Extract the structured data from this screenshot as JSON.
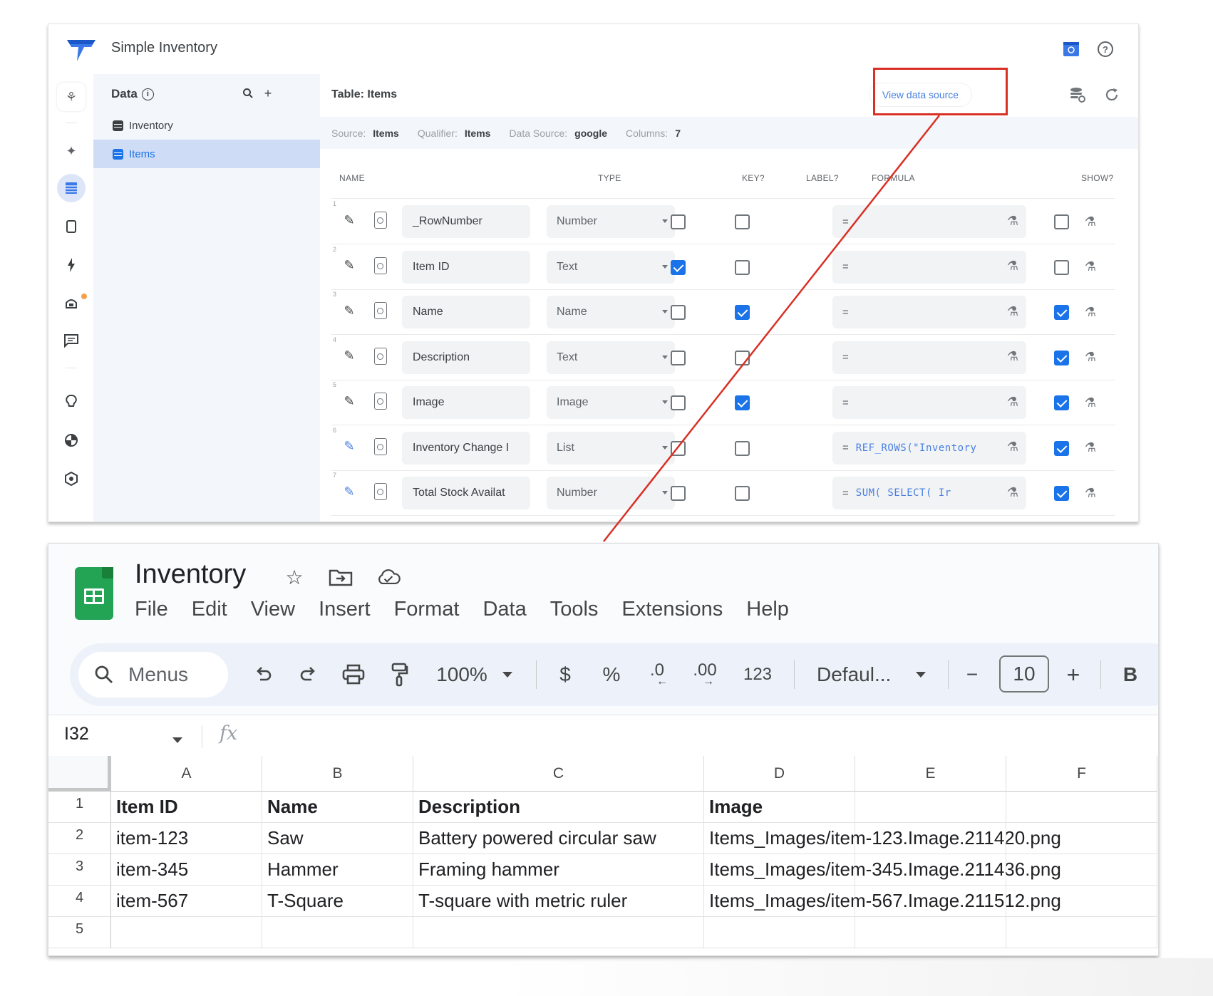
{
  "appsheet": {
    "app_title": "Simple Inventory",
    "header_icons": [
      "preview-icon",
      "help-icon"
    ],
    "rail_icons": [
      "app-flow-icon",
      "sparkle-icon",
      "data-icon",
      "views-icon",
      "actions-icon",
      "automation-icon",
      "chat-icon",
      "ideas-icon",
      "security-icon",
      "settings-icon"
    ],
    "data_panel": {
      "title": "Data",
      "tables": [
        {
          "label": "Inventory",
          "active": false
        },
        {
          "label": "Items",
          "active": true
        }
      ]
    },
    "main": {
      "title": "Table: Items",
      "view_data_source_label": "View data source",
      "meta": {
        "source_label": "Source:",
        "source_value": "Items",
        "qualifier_label": "Qualifier:",
        "qualifier_value": "Items",
        "datasource_label": "Data Source:",
        "datasource_value": "google",
        "columns_label": "Columns:",
        "columns_value": "7"
      },
      "column_headers": {
        "name": "NAME",
        "type": "TYPE",
        "key": "KEY?",
        "label": "LABEL?",
        "formula": "FORMULA",
        "show": "SHOW?"
      },
      "rows": [
        {
          "num": "1",
          "name": "_RowNumber",
          "type": "Number",
          "key": false,
          "label": false,
          "formula": "",
          "show": false,
          "edited": false
        },
        {
          "num": "2",
          "name": "Item ID",
          "type": "Text",
          "key": true,
          "label": false,
          "formula": "",
          "show": false,
          "edited": false
        },
        {
          "num": "3",
          "name": "Name",
          "type": "Name",
          "key": false,
          "label": true,
          "formula": "",
          "show": true,
          "edited": false
        },
        {
          "num": "4",
          "name": "Description",
          "type": "Text",
          "key": false,
          "label": false,
          "formula": "",
          "show": true,
          "edited": false
        },
        {
          "num": "5",
          "name": "Image",
          "type": "Image",
          "key": false,
          "label": true,
          "formula": "",
          "show": true,
          "edited": false
        },
        {
          "num": "6",
          "name": "Inventory Change I",
          "type": "List",
          "key": false,
          "label": false,
          "formula": "REF_ROWS(\"Inventory",
          "show": true,
          "edited": true
        },
        {
          "num": "7",
          "name": "Total Stock Availat",
          "type": "Number",
          "key": false,
          "label": false,
          "formula": "SUM(   SELECT(     Ir",
          "show": true,
          "edited": true
        }
      ]
    }
  },
  "sheets": {
    "doc_title": "Inventory",
    "menus": [
      "File",
      "Edit",
      "View",
      "Insert",
      "Format",
      "Data",
      "Tools",
      "Extensions",
      "Help"
    ],
    "toolbar": {
      "search_label": "Menus",
      "zoom": "100%",
      "currency": "$",
      "percent": "%",
      "decrease_decimal": ".0",
      "increase_decimal": ".00",
      "number_format": "123",
      "font": "Defaul...",
      "font_size": "10",
      "minus": "−",
      "plus": "+",
      "bold": "B"
    },
    "name_box": "I32",
    "fx": "fx",
    "columns": [
      "A",
      "B",
      "C",
      "D",
      "E",
      "F"
    ],
    "row_numbers": [
      "1",
      "2",
      "3",
      "4",
      "5"
    ],
    "cells": [
      [
        "Item ID",
        "Name",
        "Description",
        "Image",
        "",
        ""
      ],
      [
        "item-123",
        "Saw",
        "Battery powered circular saw",
        "Items_Images/item-123.Image.211420.png",
        "",
        ""
      ],
      [
        "item-345",
        "Hammer",
        "Framing hammer",
        "Items_Images/item-345.Image.211436.png",
        "",
        ""
      ],
      [
        "item-567",
        "T-Square",
        "T-square with metric ruler",
        "Items_Images/item-567.Image.211512.png",
        "",
        ""
      ],
      [
        "",
        "",
        "",
        "",
        "",
        ""
      ]
    ]
  },
  "colors": {
    "accent_blue": "#1a73e8",
    "annotation_red": "#d93025",
    "sheets_green": "#23a455"
  }
}
